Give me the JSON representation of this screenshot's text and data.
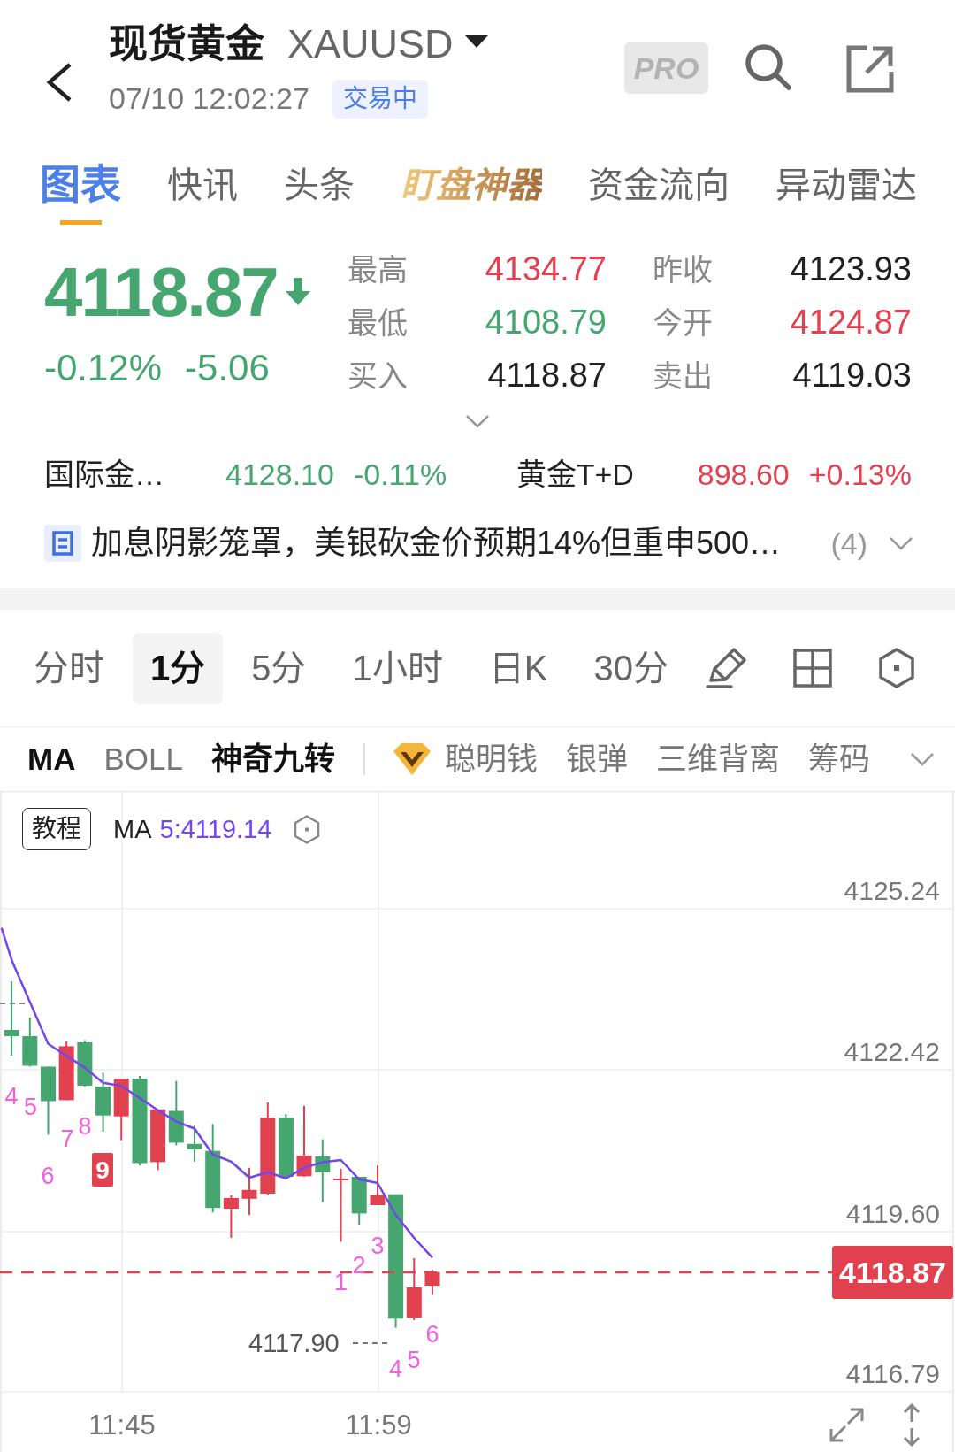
{
  "header": {
    "title": "现货黄金",
    "symbol": "XAUUSD",
    "timestamp": "07/10 12:02:27",
    "status": "交易中",
    "pro_badge": "PRO"
  },
  "tabs": [
    {
      "label": "图表",
      "selected": true,
      "kind": "plain"
    },
    {
      "label": "快讯",
      "selected": false,
      "kind": "plain"
    },
    {
      "label": "头条",
      "selected": false,
      "kind": "plain"
    },
    {
      "label": "盯盘神器",
      "selected": false,
      "kind": "featured"
    },
    {
      "label": "资金流向",
      "selected": false,
      "kind": "plain"
    },
    {
      "label": "异动雷达",
      "selected": false,
      "kind": "plain"
    }
  ],
  "quote": {
    "price": "4118.87",
    "falling": true,
    "change_percent": "-0.12%",
    "change": "-5.06",
    "stats": [
      {
        "label": "最高",
        "value": "4134.77",
        "color": "#e2424f"
      },
      {
        "label": "昨收",
        "value": "4123.93",
        "color": "#222222"
      },
      {
        "label": "最低",
        "value": "4108.79",
        "color": "#45a66f"
      },
      {
        "label": "今开",
        "value": "4124.87",
        "color": "#e2424f"
      },
      {
        "label": "买入",
        "value": "4118.87",
        "color": "#222222"
      },
      {
        "label": "卖出",
        "value": "4119.03",
        "color": "#222222"
      }
    ]
  },
  "related": [
    {
      "name": "国际金…",
      "price": "4128.10",
      "change": "-0.11%",
      "color": "#45a66f"
    },
    {
      "name": "黄金T+D",
      "price": "898.60",
      "change": "+0.13%",
      "color": "#e2424f"
    }
  ],
  "news": {
    "headline": "加息阴影笼罩，美银砍金价预期14%但重申500…",
    "count": "(4)"
  },
  "periods": [
    {
      "label": "分时",
      "selected": false
    },
    {
      "label": "1分",
      "selected": true
    },
    {
      "label": "5分",
      "selected": false
    },
    {
      "label": "1小时",
      "selected": false
    },
    {
      "label": "日K",
      "selected": false
    },
    {
      "label": "30分",
      "selected": false
    }
  ],
  "indicators": [
    {
      "label": "MA",
      "selected": true
    },
    {
      "label": "BOLL",
      "selected": false
    },
    {
      "label": "神奇九转",
      "selected": true
    }
  ],
  "more_indicators": [
    {
      "label": "聪明钱",
      "selected": false,
      "kind": "premium"
    },
    {
      "label": "银弹",
      "selected": false,
      "kind": "plain"
    },
    {
      "label": "三维背离",
      "selected": false,
      "kind": "plain"
    },
    {
      "label": "筹码",
      "selected": false,
      "kind": "plain"
    }
  ],
  "chart": {
    "tutorial": "教程",
    "ma_name": "MA",
    "ma_value": "5:4119.14",
    "price_axis": [
      "4125.24",
      "4122.42",
      "4119.60",
      "4116.79"
    ],
    "time_axis": [
      "11:45",
      "11:59"
    ],
    "last_price": "4118.87",
    "low_price": "4117.90",
    "turn_marks": [
      {
        "text": "4",
        "kind": "plain"
      },
      {
        "text": "5",
        "kind": "plain"
      },
      {
        "text": "6",
        "kind": "plain"
      },
      {
        "text": "7",
        "kind": "plain"
      },
      {
        "text": "8",
        "kind": "plain"
      },
      {
        "text": "9",
        "kind": "boxed"
      },
      {
        "text": "1",
        "kind": "plain"
      },
      {
        "text": "2",
        "kind": "plain"
      },
      {
        "text": "3",
        "kind": "plain"
      },
      {
        "text": "4",
        "kind": "plain"
      },
      {
        "text": "5",
        "kind": "plain"
      },
      {
        "text": "6",
        "kind": "plain"
      }
    ]
  }
}
